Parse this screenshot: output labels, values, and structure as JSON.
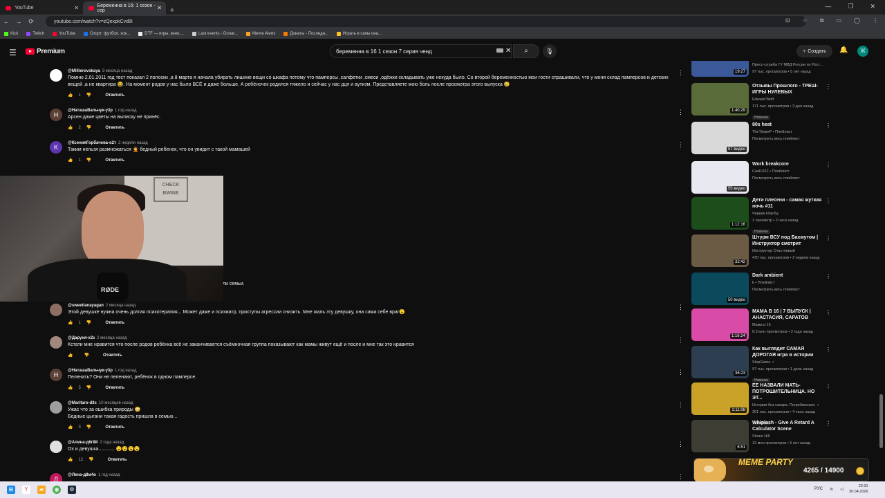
{
  "browser": {
    "tabs": [
      {
        "title": "YouTube",
        "active": false
      },
      {
        "title": "Беременна в 16: 1 сезон - сер",
        "active": true
      }
    ],
    "new_tab": "+",
    "url": "youtube.com/watch?v=zQexpkCvd8I",
    "bookmarks": [
      {
        "label": "Kick",
        "color": "#53fc18"
      },
      {
        "label": "Twitch",
        "color": "#9146ff"
      },
      {
        "label": "YouTube",
        "color": "#ff0033"
      },
      {
        "label": "Спорт: футбол, хок...",
        "color": "#1a73e8"
      },
      {
        "label": "DTF — игры, кино,...",
        "color": "#eeeeee"
      },
      {
        "label": "Last events - Donat...",
        "color": "#cccccc"
      },
      {
        "label": "Meme Alerts",
        "color": "#f5a623"
      },
      {
        "label": "Донаты - Последн...",
        "color": "#f57c00"
      },
      {
        "label": "Играть в сапы она...",
        "color": "#fbc02d"
      }
    ]
  },
  "youtube": {
    "logo": "Premium",
    "search_value": "беременна в 16 1 сезон 7 серия ченд",
    "create_label": "Создать",
    "avatar_letter": "Ж"
  },
  "comments": [
    {
      "author": "@Millierovskaya",
      "time": "3 месяца назад",
      "avatar": "",
      "avatar_color": "#ffffff",
      "text": "Помню 2.01.2011 год тест показал 2 полоски ,а 8 марта я начала убирать лишние вещи со шкафа потому что памперсы ,салфетки ,смеси ,одёжки складывать уже некуда было.  Со второй беременностью мои гости спрашивали, что у меня склад памперсов и детских вещей ,а не квартира 😂. На момент родов у нас было ВСЁ и даже больше.  А ребёночек родился тяжело и сейчас у нас дцп и аутизм.  Представляете мою боль после просмотра этого выпуска 😢",
      "likes": "1",
      "reply": "Ответить"
    },
    {
      "author": "@НаташаВальчук-у3р",
      "time": "1 год назад",
      "avatar": "Н",
      "avatar_color": "#5d4037",
      "text": "Арсен даже цветы на выписку не принёс.",
      "likes": "2",
      "reply": "Ответить"
    },
    {
      "author": "@КсенияГорбачева-о2т",
      "time": "2 недели назад",
      "avatar": "K",
      "avatar_color": "#5e35b1",
      "text": "Таким нельзя размножаться 🤦 бедный ребенок, что он увидит с такой мамашей",
      "likes": "1",
      "reply": "Ответить"
    },
    {
      "author": "",
      "time": "",
      "avatar": "",
      "avatar_color": "#0f0f0f",
      "text": "ет,да,она невоспитанна,да замка,но это же не ее вина.не было модели семьи.",
      "likes": "",
      "reply": ""
    },
    {
      "author": "@sweetlanayagan",
      "time": "2 месяца назад",
      "avatar": "",
      "avatar_color": "#8d6e63",
      "text": "Этой девушке нужна очень долгая психотерапия... Может даже и психиатр, приступы агрессии снизить. Мне жаль эту девушку, она сама себе враг😮",
      "likes": "1",
      "reply": "Ответить"
    },
    {
      "author": "@Даруня-х2з",
      "time": "2 месяца назад",
      "avatar": "",
      "avatar_color": "#a1887f",
      "text": "Кстати мне нравится что после родов ребёнка всё не заканчивается съёмночная группа показывают как мамы живут ещё и после и мне так это нравится",
      "likes": "",
      "reply": "Ответить"
    },
    {
      "author": "@НаташаВальчук-у3р",
      "time": "1 год назад",
      "avatar": "Н",
      "avatar_color": "#5d4037",
      "text": "Пеленать?  Они не пеленают, ребёнок  в одном памперсе.",
      "likes": "5",
      "reply": "Ответить"
    },
    {
      "author": "@Maritaro-d3c",
      "time": "10 месяцев назад",
      "avatar": "",
      "avatar_color": "#9e9e9e",
      "text": "Ужас что за ошибка природы 😳\nБедные цыгани такая гадость пришла в семью...",
      "likes": "3",
      "reply": "Ответить"
    },
    {
      "author": "@Алина-д6г8й",
      "time": "2 года назад",
      "avatar": "",
      "avatar_color": "#e0e0e0",
      "text": "Ох и девушка............ 😮😮😮😮",
      "likes": "12",
      "reply": "Ответить"
    },
    {
      "author": "@Лена-д8м4о",
      "time": "1 год назад",
      "avatar": "Л",
      "avatar_color": "#c2185b",
      "text": "",
      "likes": "",
      "reply": ""
    }
  ],
  "webcam": {
    "sign": "CHECK\nBWINE",
    "mic_brand": "RØDE"
  },
  "related": [
    {
      "title": "",
      "meta1": "Пресс-служба ГУ МВД России по Рост...",
      "meta2": "97 тыс. просмотров • 5 лет назад",
      "duration": "19:27",
      "badge": "",
      "thumb": "#3b5998"
    },
    {
      "title": "Отзывы Прошлого - ТРЕШ-ИГРЫ НУЛЕВЫХ",
      "meta1": "Edward Wolf",
      "meta2": "171 тыс. просмотров • 3 дня назад",
      "duration": "1:40:29",
      "badge": "Новинка",
      "thumb": "#5a6b3a"
    },
    {
      "title": "80s heat",
      "meta1": "TheTimpeP • Плейлист",
      "meta2": "Посмотреть весь плейлист",
      "duration": "57 видео",
      "badge": "",
      "thumb": "#d9d9d9"
    },
    {
      "title": "Work breakcore",
      "meta1": "Coal1022 • Плейлист",
      "meta2": "Посмотреть весь плейлист",
      "duration": "55 видео",
      "badge": "",
      "thumb": "#e8e8f0"
    },
    {
      "title": "Дети плесени - самая жуткая ночь #11",
      "meta1": "Чердак Нор-Бу",
      "meta2": "1 просмотр • 2 часа назад",
      "duration": "1:12:16",
      "badge": "Новинка",
      "thumb": "#1d4d1a"
    },
    {
      "title": "Штурм ВСУ под Бахмутом | Инструктор смотрит",
      "meta1": "Инструктор Счастливый",
      "meta2": "470 тыс. просмотров • 2 недели назад",
      "duration": "32:42",
      "badge": "",
      "thumb": "#6b5a44"
    },
    {
      "title": "Dark ambient",
      "meta1": "k • Плейлист",
      "meta2": "Посмотреть весь плейлист",
      "duration": "50 видео",
      "badge": "",
      "thumb": "#0b4a5c"
    },
    {
      "title": "МАМА В 16 | 7 ВЫПУСК | АНАСТАСИЯ, САРАТОВ",
      "meta1": "Мама в 16",
      "meta2": "8,3 млн просмотров • 2 года назад",
      "duration": "1:16:24",
      "badge": "",
      "thumb": "#d84ba6"
    },
    {
      "title": "Как выглядит САМАЯ ДОРОГАЯ игра в истории",
      "meta1": "StopGame ✓",
      "meta2": "97 тыс. просмотров • 1 день назад",
      "duration": "36:23",
      "badge": "Новинка",
      "thumb": "#2c3e50"
    },
    {
      "title": "ЕЕ НАЗВАЛИ МАТЬ-ПОТРОШИТЕЛЬНИЦА. НО ЭТ...",
      "meta1": "Истории без сахара. Погребижская. ✓",
      "meta2": "301 тыс. просмотров • 4 часа назад",
      "duration": "1:11:08",
      "badge": "Новинка",
      "thumb": "#c9a227"
    },
    {
      "title": "Whiplash - Give A Retard A Calculator Scene",
      "meta1": "Shane Hill",
      "meta2": "12 млн просмотров • 5 лет назад",
      "duration": "6:51",
      "badge": "",
      "thumb": "#3d3d33"
    }
  ],
  "alert": {
    "title": "MEME PARTY",
    "count": "4265 / 14900"
  },
  "taskbar": {
    "lang": "РУС",
    "time": "22:31",
    "date": "30.04.2026"
  }
}
